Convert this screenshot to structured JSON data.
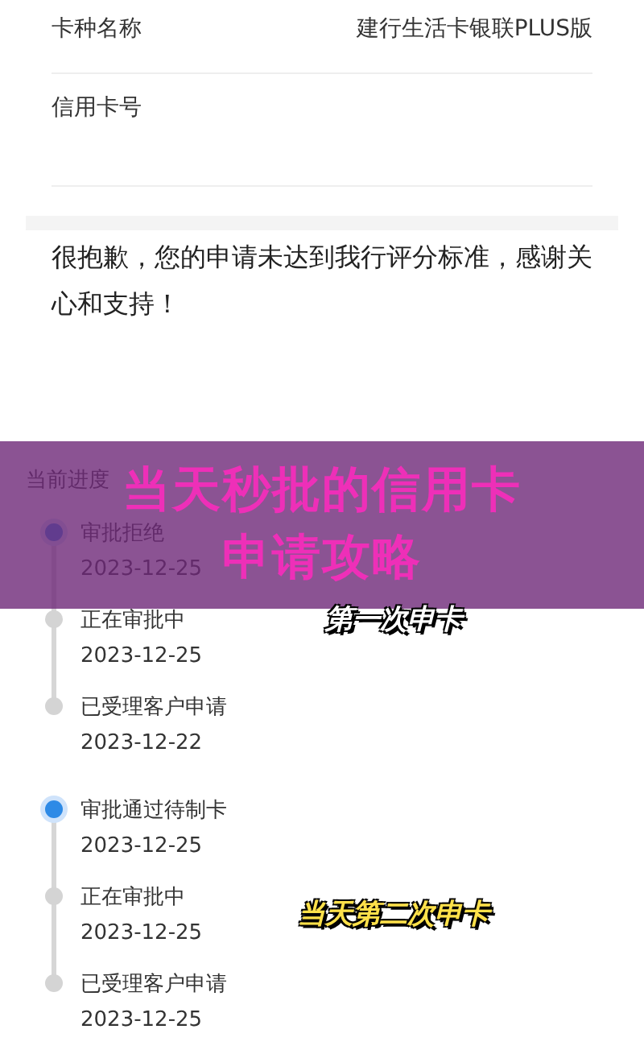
{
  "fields": [
    {
      "label": "卡种名称",
      "value": "建行生活卡银联PLUS版"
    },
    {
      "label": "信用卡号"
    }
  ],
  "message": "很抱歉，您的申请未达到我行评分标准，感谢关心和支持！",
  "progress": {
    "title": "当前进度",
    "groups": [
      {
        "steps": [
          {
            "status": "审批拒绝",
            "date": "2023-12-25",
            "current": true
          },
          {
            "status": "正在审批中",
            "date": "2023-12-25",
            "current": false
          },
          {
            "status": "已受理客户申请",
            "date": "2023-12-22",
            "current": false
          }
        ]
      },
      {
        "steps": [
          {
            "status": "审批通过待制卡",
            "date": "2023-12-25",
            "current": true
          },
          {
            "status": "正在审批中",
            "date": "2023-12-25",
            "current": false
          },
          {
            "status": "已受理客户申请",
            "date": "2023-12-25",
            "current": false
          }
        ]
      }
    ]
  },
  "banner": {
    "title_lines": [
      "当天秒批的信用卡",
      "申请攻略"
    ]
  },
  "captions": [
    {
      "kind": "outline",
      "text": "第一次申卡"
    },
    {
      "kind": "yellow",
      "text": "当天第二次申卡"
    }
  ]
}
